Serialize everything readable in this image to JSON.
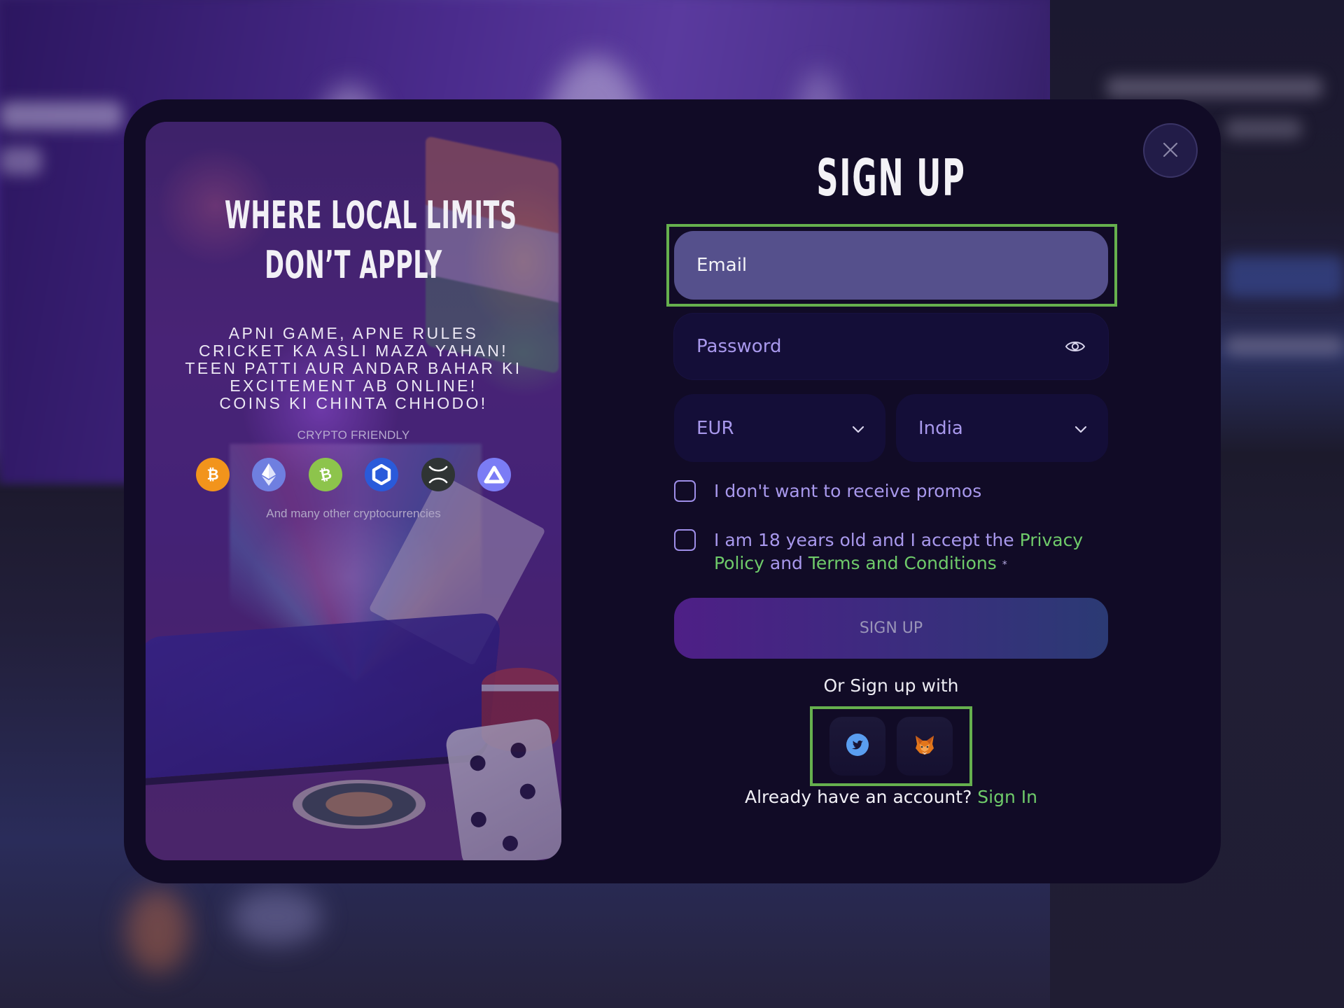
{
  "promo": {
    "title_lines": [
      "WHERE LOCAL LIMITS",
      "DON’T APPLY"
    ],
    "tagline_lines": [
      "APNI GAME, APNE RULES",
      "CRICKET KA ASLI MAZA YAHAN!",
      "TEEN PATTI AUR ANDAR BAHAR KI",
      "EXCITEMENT AB ONLINE!",
      "COINS KI CHINTA CHHODO!"
    ],
    "crypto_label": "CRYPTO FRIENDLY",
    "crypto_icons": [
      {
        "name": "bitcoin-icon",
        "symbol": "₿",
        "color": "#f2941c"
      },
      {
        "name": "ethereum-icon",
        "symbol": "◆",
        "color": "#6f7fe0"
      },
      {
        "name": "bitcoin-cash-icon",
        "symbol": "₿",
        "color": "#8dc44c"
      },
      {
        "name": "chainlink-icon",
        "symbol": "⬡",
        "color": "#2a5ada"
      },
      {
        "name": "xrp-icon",
        "symbol": "✕",
        "color": "#2f3434"
      },
      {
        "name": "triangle-coin-icon",
        "symbol": "▲",
        "color": "#7b7cf5"
      }
    ],
    "crypto_more": "And many other cryptocurrencies"
  },
  "form": {
    "title": "SIGN UP",
    "email": {
      "placeholder": "Email",
      "value": ""
    },
    "password": {
      "placeholder": "Password",
      "value": ""
    },
    "currency": {
      "selected": "EUR"
    },
    "country": {
      "selected": "India"
    },
    "promos_checkbox": {
      "label": "I don't want to receive promos",
      "checked": false
    },
    "terms_checkbox": {
      "prefix": "I am 18 years old and I accept the ",
      "privacy_link": "Privacy Policy",
      "middle": " and ",
      "terms_link": "Terms and Conditions",
      "required_mark": "*",
      "checked": false
    },
    "submit_label": "SIGN UP",
    "social_label": "Or Sign up with",
    "social_buttons": [
      {
        "name": "twitter",
        "color": "#5a9ef0"
      },
      {
        "name": "metamask",
        "color": "#e2761b"
      }
    ],
    "account_prompt": "Already have an account?",
    "sign_in_link": "Sign In"
  },
  "colors": {
    "modal_bg": "#110b26",
    "accent_green": "#6fcb6a",
    "accent_purple": "#a898ec",
    "highlight": "#66b04e"
  }
}
